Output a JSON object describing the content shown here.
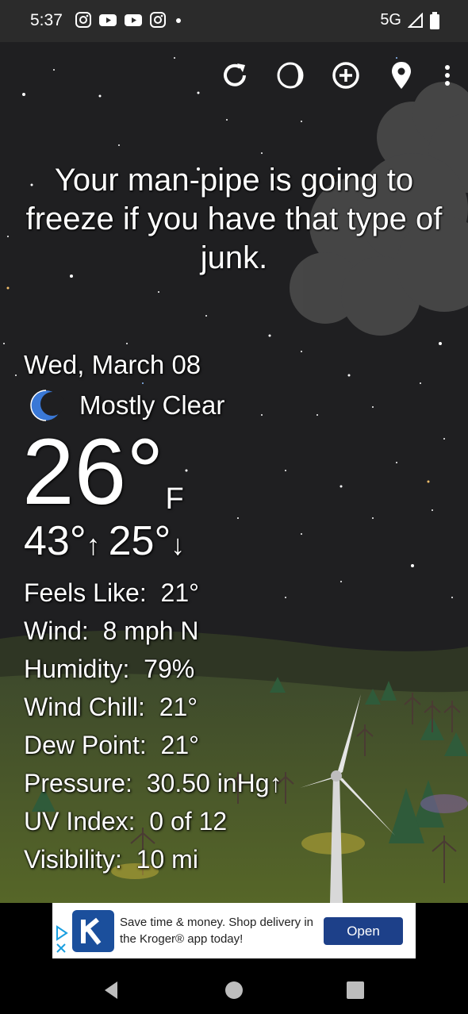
{
  "status_bar": {
    "time": "5:37",
    "network": "5G",
    "icons": [
      "instagram-icon",
      "youtube-icon",
      "youtube-icon",
      "instagram-icon",
      "dot-icon",
      "signal-icon",
      "battery-icon"
    ]
  },
  "toolbar": {
    "buttons": [
      "refresh-icon",
      "moon-phase-icon",
      "add-location-icon",
      "location-pin-icon",
      "more-vert-icon"
    ]
  },
  "quote": "Your man-pipe is going to freeze if you have that type of junk.",
  "weather": {
    "date": "Wed, March 08",
    "condition": "Mostly Clear",
    "condition_icon": "crescent-moon-icon",
    "temperature": "26°",
    "unit": "F",
    "high": "43°",
    "low": "25°",
    "high_arrow": "↑",
    "low_arrow": "↓"
  },
  "details": [
    {
      "label": "Feels Like:",
      "value": "21°"
    },
    {
      "label": "Wind:",
      "value": "8 mph N"
    },
    {
      "label": "Humidity:",
      "value": "79%"
    },
    {
      "label": "Wind Chill:",
      "value": "21°"
    },
    {
      "label": "Dew Point:",
      "value": "21°"
    },
    {
      "label": "Pressure:",
      "value": "30.50 inHg↑"
    },
    {
      "label": "UV Index:",
      "value": "0 of 12"
    },
    {
      "label": "Visibility:",
      "value": "10 mi"
    }
  ],
  "ad": {
    "text": "Save time & money. Shop delivery in the Kroger® app today!",
    "button_label": "Open"
  },
  "colors": {
    "sky": "#1f1f21",
    "ad_button": "#1d4089",
    "moon_icon": "#3a78d6"
  }
}
